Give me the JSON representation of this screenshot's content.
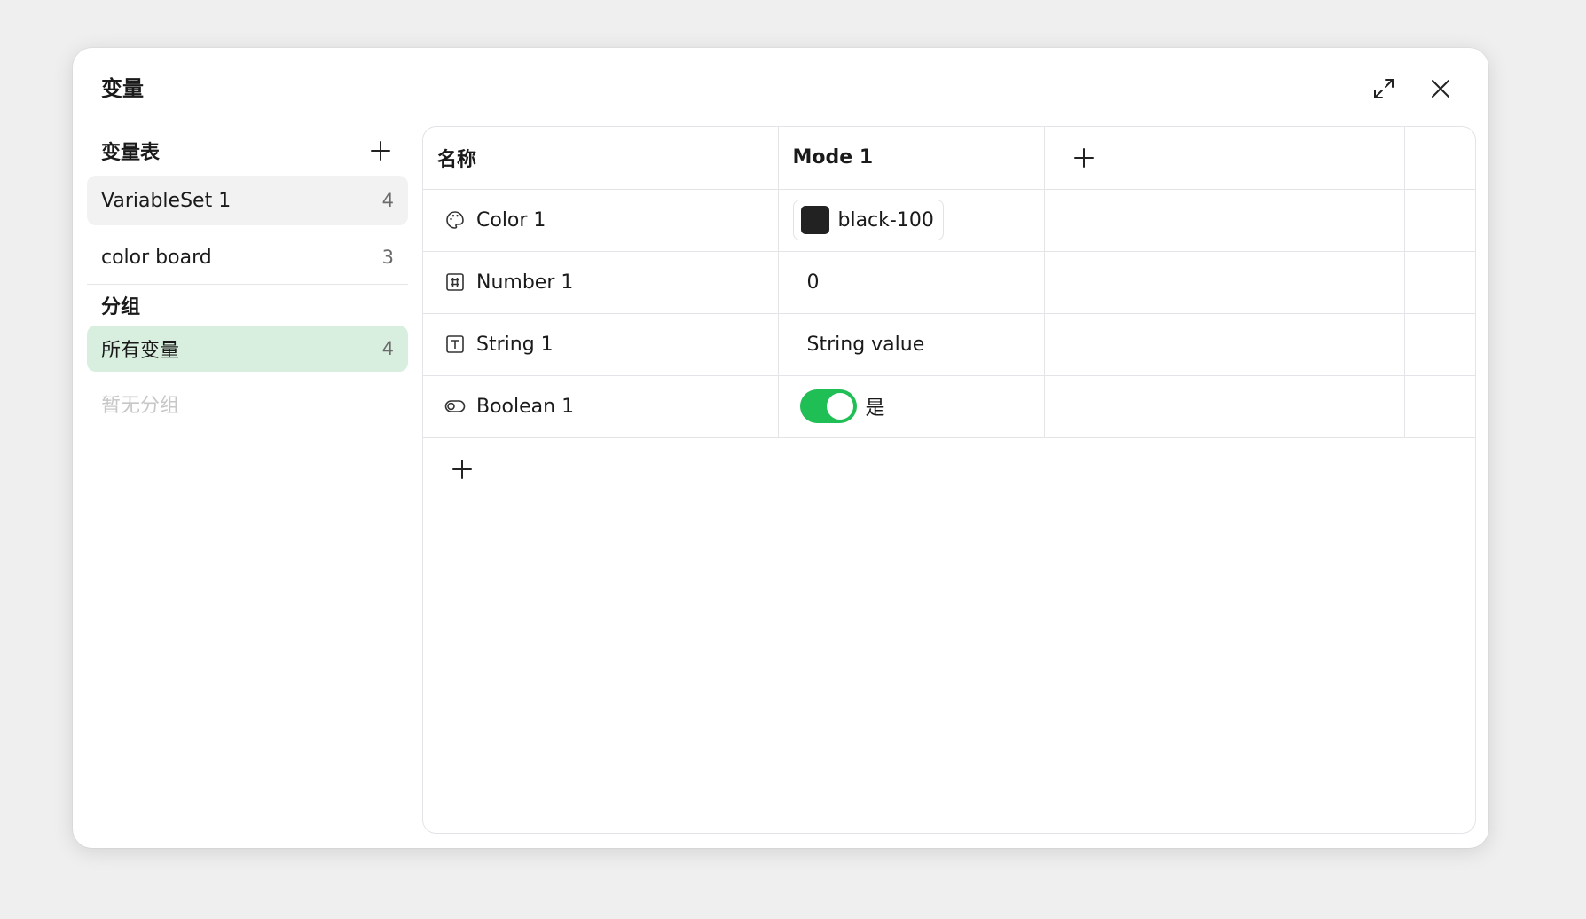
{
  "dialog": {
    "title": "变量"
  },
  "sidebar": {
    "sets_label": "变量表",
    "sets": [
      {
        "name": "VariableSet 1",
        "count": "4"
      },
      {
        "name": "color board",
        "count": "3"
      }
    ],
    "groups_label": "分组",
    "groups": [
      {
        "name": "所有变量",
        "count": "4"
      }
    ],
    "empty_groups_text": "暂无分组"
  },
  "table": {
    "headers": {
      "name": "名称",
      "mode1": "Mode 1"
    },
    "rows": [
      {
        "type_icon": "palette-icon",
        "name": "Color 1",
        "value": "black-100",
        "swatch_color": "#222222"
      },
      {
        "type_icon": "hash-icon",
        "name": "Number 1",
        "value": "0"
      },
      {
        "type_icon": "text-icon",
        "name": "String 1",
        "value": "String value"
      },
      {
        "type_icon": "toggle-icon",
        "name": "Boolean 1",
        "value": "是",
        "toggle_on": true
      }
    ]
  },
  "colors": {
    "toggle_on": "#1fbf55",
    "group_selected_bg": "#d8efe0",
    "set_selected_bg": "#f2f2f2"
  }
}
